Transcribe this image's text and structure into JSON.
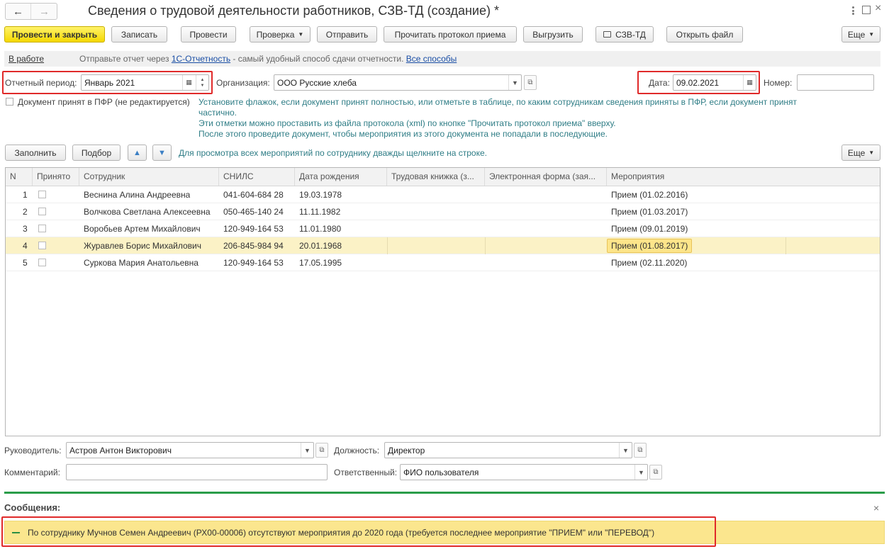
{
  "window": {
    "title": "Сведения о трудовой деятельности работников, СЗВ-ТД (создание) *",
    "nav_back": "←",
    "nav_fwd": "→"
  },
  "toolbar": {
    "post_close": "Провести и закрыть",
    "save": "Записать",
    "post": "Провести",
    "check": "Проверка",
    "send": "Отправить",
    "read_protocol": "Прочитать протокол приема",
    "export": "Выгрузить",
    "print_szv": "СЗВ-ТД",
    "open_file": "Открыть файл",
    "more": "Еще"
  },
  "status_line": {
    "state": "В работе",
    "text_before": "Отправьте отчет через ",
    "link": "1С-Отчетность",
    "text_after": " - самый удобный способ сдачи отчетности. ",
    "all_ways": "Все способы"
  },
  "header": {
    "period_label": "Отчетный период:",
    "period_value": "Январь 2021",
    "org_label": "Организация:",
    "org_value": "ООО Русские хлеба",
    "date_label": "Дата:",
    "date_value": "09.02.2021",
    "number_label": "Номер:",
    "number_value": ""
  },
  "accepted": {
    "label": "Документ принят в ПФР (не редактируется)",
    "hint1": "Установите флажок, если документ принят полностью, или отметьте в таблице, по каким сотрудникам сведения приняты в ПФР, если документ принят",
    "hint2": "частично.",
    "hint3": "Эти отметки можно проставить из файла протокола (xml) по кнопке \"Прочитать протокол приема\" вверху.",
    "hint4": "После этого проведите документ, чтобы мероприятия из этого документа не попадали в последующие."
  },
  "table_toolbar": {
    "fill": "Заполнить",
    "select": "Подбор",
    "hint": "Для просмотра всех мероприятий по сотруднику дважды щелкните на строке.",
    "more": "Еще"
  },
  "table": {
    "columns": [
      "N",
      "Принято",
      "Сотрудник",
      "СНИЛС",
      "Дата рождения",
      "Трудовая книжка (з...",
      "Электронная форма (зая...",
      "Мероприятия"
    ],
    "rows": [
      {
        "n": "1",
        "name": "Веснина Алина Андреевна",
        "snils": "041-604-684 28",
        "birth": "19.03.1978",
        "event": "Прием (01.02.2016)"
      },
      {
        "n": "2",
        "name": "Волчкова Светлана Алексеевна",
        "snils": "050-465-140 24",
        "birth": "11.11.1982",
        "event": "Прием (01.03.2017)"
      },
      {
        "n": "3",
        "name": "Воробьев Артем Михайлович",
        "snils": "120-949-164 53",
        "birth": "11.01.1980",
        "event": "Прием (09.01.2019)"
      },
      {
        "n": "4",
        "name": "Журавлев Борис Михайлович",
        "snils": "206-845-984 94",
        "birth": "20.01.1968",
        "event": "Прием (01.08.2017)"
      },
      {
        "n": "5",
        "name": "Суркова Мария Анатольевна",
        "snils": "120-949-164 53",
        "birth": "17.05.1995",
        "event": "Прием (02.11.2020)"
      }
    ]
  },
  "footer": {
    "head_label": "Руководитель:",
    "head_value": "Астров Антон Викторович",
    "position_label": "Должность:",
    "position_value": "Директор",
    "comment_label": "Комментарий:",
    "comment_value": "",
    "responsible_label": "Ответственный:",
    "responsible_value": "ФИО пользователя"
  },
  "messages": {
    "title": "Сообщения:",
    "text": "По сотруднику Мучнов Семен Андреевич (РХ00-00006) отсутствуют мероприятия до 2020 года (требуется последнее мероприятие \"ПРИЕМ\" или \"ПЕРЕВОД\")"
  },
  "colors": {
    "accent_yellow": "#f5d800",
    "hint_teal": "#2f7d86",
    "highlight_red": "#e02a2a",
    "message_bar": "#fbe68e",
    "divider_green": "#2a9d49"
  }
}
